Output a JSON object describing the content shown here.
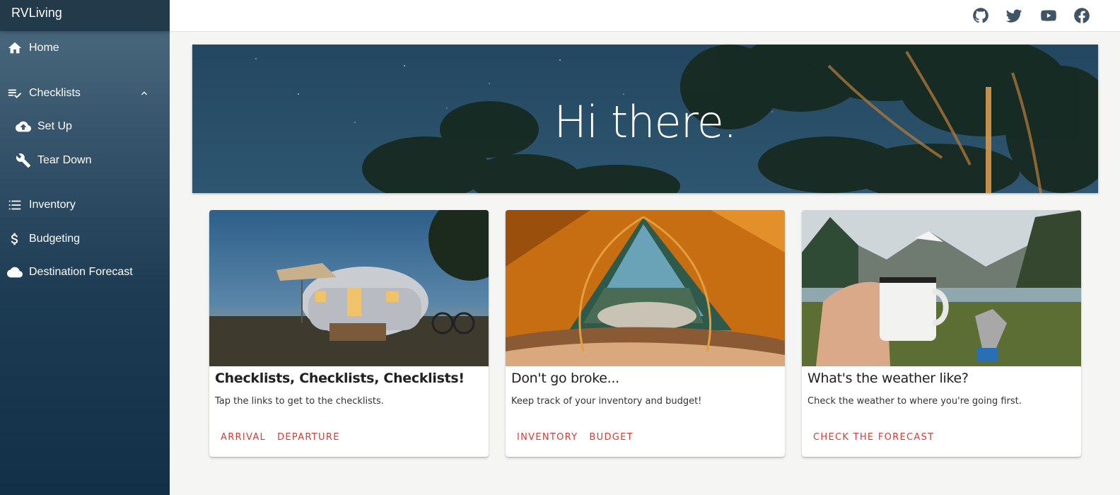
{
  "app": {
    "title": "RVLiving"
  },
  "sidebar": {
    "items": [
      {
        "label": "Home",
        "icon": "home-icon"
      },
      {
        "label": "Checklists",
        "icon": "playlist-check-icon",
        "expanded": true
      },
      {
        "label": "Set Up",
        "icon": "cloud-upload-icon"
      },
      {
        "label": "Tear Down",
        "icon": "wrench-icon"
      },
      {
        "label": "Inventory",
        "icon": "list-icon"
      },
      {
        "label": "Budgeting",
        "icon": "dollar-icon"
      },
      {
        "label": "Destination Forecast",
        "icon": "cloud-icon"
      }
    ]
  },
  "header": {
    "social": [
      "github-icon",
      "twitter-icon",
      "youtube-icon",
      "facebook-icon"
    ]
  },
  "hero": {
    "title": "Hi there."
  },
  "cards": [
    {
      "title": "Checklists, Checklists, Checklists!",
      "text": "Tap the links to get to the checklists.",
      "actions": [
        "ARRIVAL",
        "DEPARTURE"
      ]
    },
    {
      "title": "Don't go broke...",
      "text": "Keep track of your inventory and budget!",
      "actions": [
        "INVENTORY",
        "BUDGET"
      ]
    },
    {
      "title": "What's the weather like?",
      "text": "Check the weather to where you're going first.",
      "actions": [
        "CHECK THE FORECAST"
      ]
    }
  ],
  "colors": {
    "accent": "#d53b36",
    "sidebar_top": "#4d6b80",
    "sidebar_bottom": "#123048"
  }
}
